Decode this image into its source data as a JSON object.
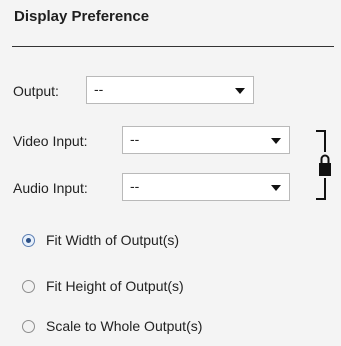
{
  "panel": {
    "title": "Display Preference"
  },
  "fields": {
    "output": {
      "label": "Output:",
      "value": "--"
    },
    "video_input": {
      "label": "Video Input:",
      "value": "--"
    },
    "audio_input": {
      "label": "Audio Input:",
      "value": "--"
    }
  },
  "lock": {
    "icon": "lock-icon",
    "state": "locked"
  },
  "scaling_options": [
    {
      "label": "Fit Width of Output(s)",
      "selected": true
    },
    {
      "label": "Fit Height of Output(s)",
      "selected": false
    },
    {
      "label": "Scale to Whole Output(s)",
      "selected": false
    }
  ]
}
